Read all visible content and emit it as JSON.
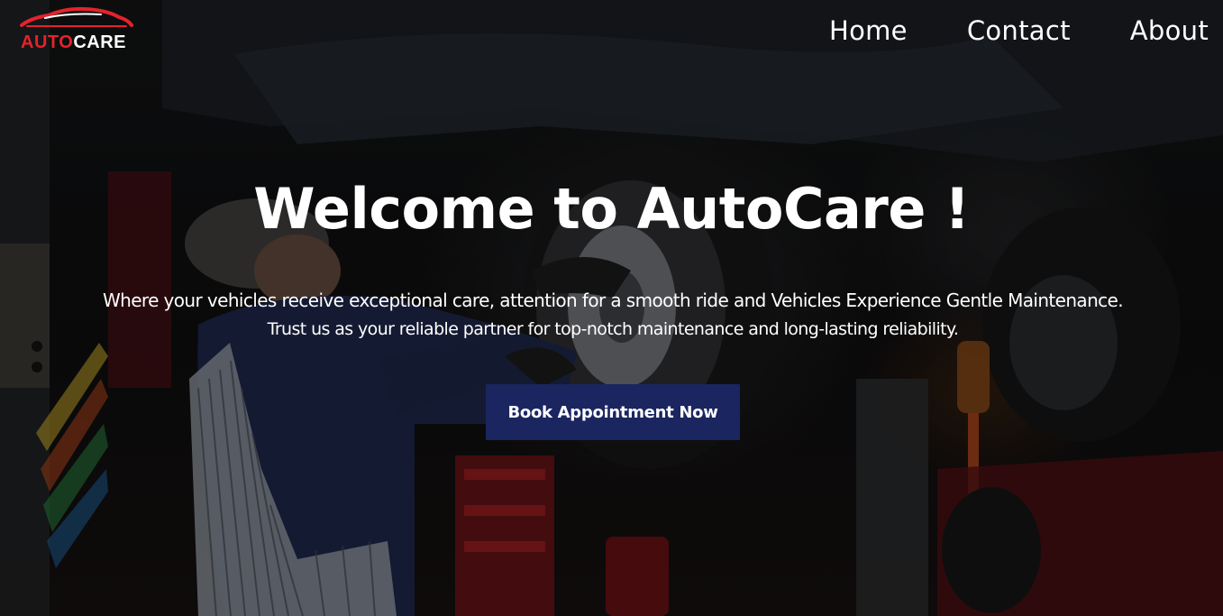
{
  "brand": {
    "logo_word_1": "AUTO",
    "logo_word_2": "CARE",
    "accent_color": "#e4232b"
  },
  "nav": {
    "items": [
      {
        "label": "Home"
      },
      {
        "label": "Contact"
      },
      {
        "label": "About"
      }
    ]
  },
  "hero": {
    "headline": "Welcome to AutoCare !",
    "subtitle_line_1": "Where your vehicles receive exceptional care, attention for a smooth ride and Vehicles Experience Gentle Maintenance.",
    "subtitle_line_2": "Trust us as your reliable partner for top-notch maintenance and long-lasting reliability.",
    "cta_label": "Book Appointment Now",
    "cta_color": "#1b2560"
  }
}
